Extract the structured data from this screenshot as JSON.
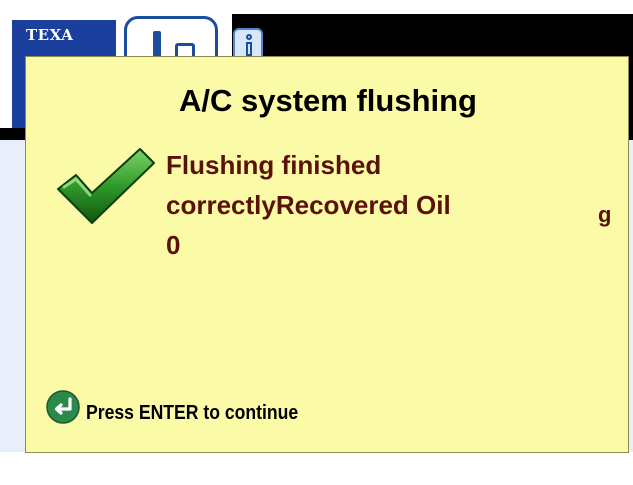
{
  "app": {
    "logo_text": "TEXA"
  },
  "dialog": {
    "title": "A/C system flushing",
    "message_lines": [
      "Flushing finished",
      "correctlyRecovered Oil",
      "0"
    ],
    "edge_glyph": "g",
    "footer_text": "Press ENTER to continue",
    "icons": {
      "status": "checkmark-icon",
      "enter": "enter-key-icon"
    }
  },
  "colors": {
    "dialog_background": "#fbfaa6",
    "message_text": "#5a1208",
    "check_green": "#2f9a2a",
    "enter_icon_green": "#2b8a4a",
    "header_blue": "#1a3f9c"
  }
}
